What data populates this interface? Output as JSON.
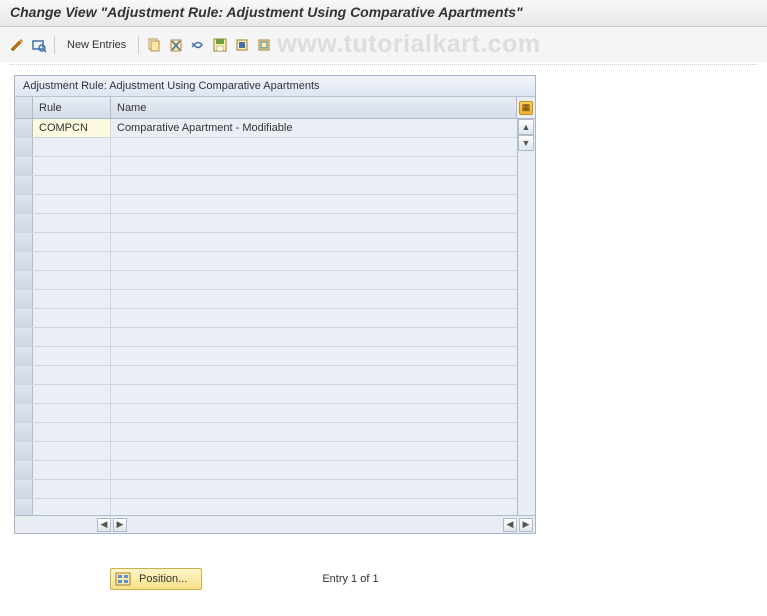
{
  "header": {
    "title": "Change View \"Adjustment Rule: Adjustment Using Comparative Apartments\""
  },
  "toolbar": {
    "new_entries_label": "New Entries",
    "watermark": "www.tutorialkart.com"
  },
  "grid": {
    "title": "Adjustment Rule: Adjustment Using Comparative Apartments",
    "columns": {
      "rule": "Rule",
      "name": "Name"
    },
    "rows": [
      {
        "rule": "COMPCN",
        "name": "Comparative Apartment - Modifiable"
      }
    ],
    "empty_row_count": 20
  },
  "footer": {
    "position_label": "Position...",
    "entry_text": "Entry 1 of 1"
  }
}
